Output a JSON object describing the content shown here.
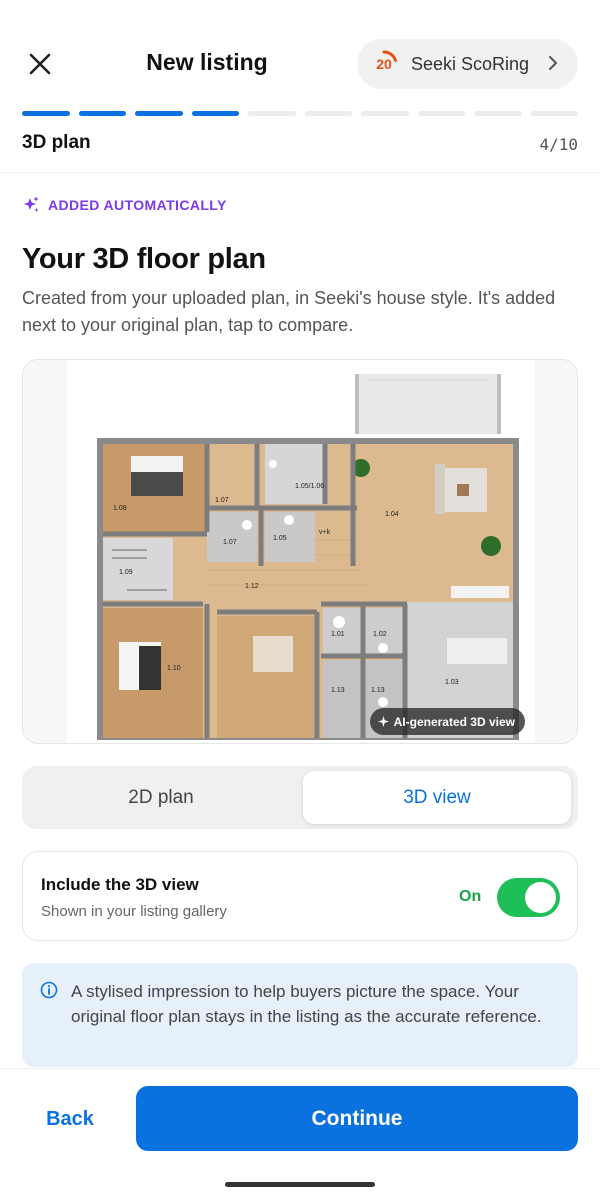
{
  "header": {
    "title": "New listing",
    "score": {
      "value": "20",
      "label": "Seeki ScoRing",
      "ring_fraction": 0.2,
      "ring_color": "#e8501a"
    }
  },
  "progress": {
    "current_step": 4,
    "total_steps": 10,
    "step_name": "3D plan",
    "step_counter": "4/10",
    "active_color": "#0a72de"
  },
  "auto_tag": {
    "label": "ADDED AUTOMATICALLY",
    "icon": "sparkles-icon",
    "color": "#7c3aed"
  },
  "content": {
    "heading": "Your 3D floor plan",
    "description": "Created from your uploaded plan, in Seeki's house style. It's added next to your original plan, tap to compare."
  },
  "floor_plan": {
    "badge": "AI-generated 3D view",
    "rooms": [
      "1.08",
      "1.07",
      "1.05/1.06",
      "1.04",
      "1.07",
      "1.05",
      "v+k",
      "1.09",
      "1.12",
      "1.01",
      "1.02",
      "1.10",
      "1.13",
      "1.13",
      "1.03"
    ]
  },
  "view_toggle": {
    "options": [
      "2D plan",
      "3D view"
    ],
    "selected": "3D view"
  },
  "include_3d": {
    "title": "Include the 3D view",
    "subtitle": "Shown in your listing gallery",
    "state_label": "On",
    "enabled": true
  },
  "info": {
    "icon": "info-icon",
    "text": "A stylised impression to help buyers picture the space. Your original floor plan stays in the listing as the accurate reference."
  },
  "footer": {
    "back_label": "Back",
    "continue_label": "Continue"
  }
}
